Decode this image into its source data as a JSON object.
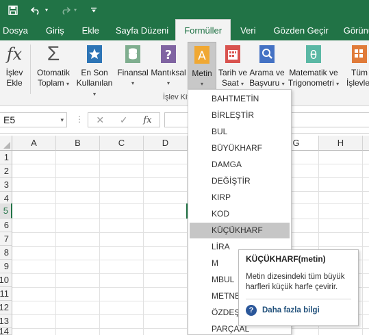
{
  "quick_access": {
    "icons": [
      "save-icon",
      "undo-icon",
      "redo-icon",
      "customize-icon"
    ]
  },
  "tabs": [
    "Dosya",
    "Giriş",
    "Ekle",
    "Sayfa Düzeni",
    "Formüller",
    "Veri",
    "Gözden Geçir",
    "Görünüm"
  ],
  "active_tab": "Formüller",
  "ribbon": {
    "insert_function": {
      "line1": "İşlev",
      "line2": "Ekle"
    },
    "autosum": {
      "line1": "Otomatik",
      "line2": "Toplam"
    },
    "recent": {
      "line1": "En Son",
      "line2": "Kullanılan"
    },
    "financial": {
      "line1": "Finansal",
      "line2": ""
    },
    "logical": {
      "line1": "Mantıksal",
      "line2": ""
    },
    "text": {
      "line1": "Metin",
      "line2": ""
    },
    "datetime": {
      "line1": "Tarih ve",
      "line2": "Saat"
    },
    "lookup": {
      "line1": "Arama ve",
      "line2": "Başvuru"
    },
    "math": {
      "line1": "Matematik ve",
      "line2": "Trigonometri"
    },
    "more": {
      "line1": "Tüm",
      "line2": "İşlevler"
    },
    "group_label": "İşlev Kit"
  },
  "formula_bar": {
    "name_box": "E5",
    "cancel_symbol": "✕",
    "enter_symbol": "✓",
    "fx_symbol": "fx",
    "value": ""
  },
  "grid": {
    "columns": [
      "A",
      "B",
      "C",
      "D",
      "G",
      "H"
    ],
    "rows": [
      "1",
      "2",
      "3",
      "4",
      "5",
      "6",
      "7",
      "8",
      "9",
      "10",
      "11",
      "12",
      "13",
      "14"
    ],
    "selected_row": "5"
  },
  "text_menu": {
    "items": [
      "BAHTMETİN",
      "BİRLEŞTİR",
      "BUL",
      "BÜYÜKHARF",
      "DAMGA",
      "DEĞİŞTİR",
      "KIRP",
      "KOD",
      "KÜÇÜKHARF",
      "LİRA",
      "M",
      "MBUL",
      "METNEÇ",
      "ÖZDEŞ",
      "PARÇAAL"
    ],
    "highlighted": "KÜÇÜKHARF"
  },
  "tooltip": {
    "title": "KÜÇÜKHARF(metin)",
    "body": "Metin dizesindeki tüm büyük harfleri küçük harfe çevirir.",
    "link": "Daha fazla bilgi"
  },
  "colors": {
    "accent": "#217346",
    "link": "#1e4e79",
    "help_icon": "#2b579a"
  }
}
